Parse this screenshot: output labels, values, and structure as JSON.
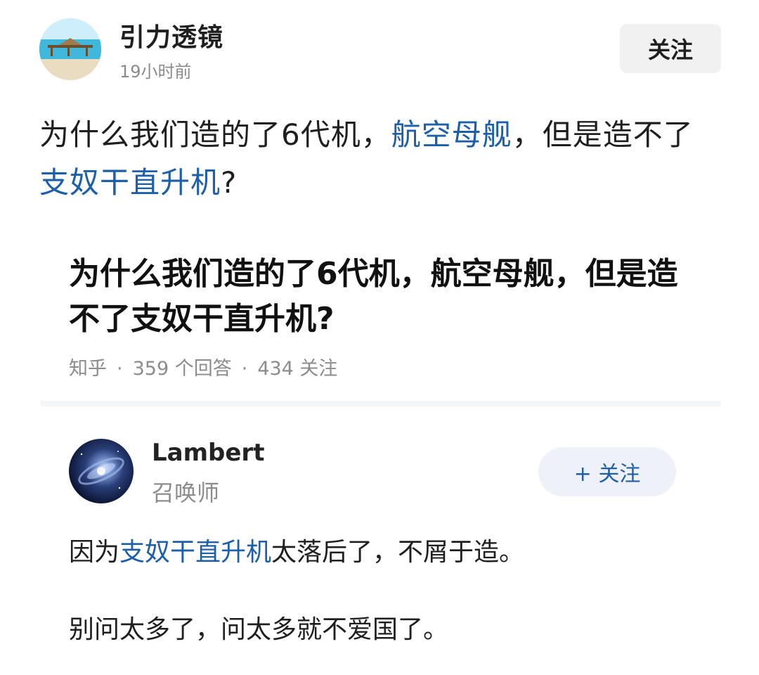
{
  "post": {
    "author": "引力透镜",
    "time": "19小时前",
    "follow_label": "关注",
    "text_part1": "为什么我们造的了6代机，",
    "link1": "航空母舰",
    "text_part2": "，但是造不了",
    "link2": "支奴干直升机",
    "text_part3": "?"
  },
  "embed": {
    "title": "为什么我们造的了6代机，航空母舰，但是造不了支奴干直升机?",
    "source": "知乎",
    "answers": "359 个回答",
    "followers": "434 关注",
    "separator": "·"
  },
  "answer": {
    "author": "Lambert",
    "title": "召唤师",
    "follow_label": "+ 关注",
    "line1_pre": "因为",
    "line1_link": "支奴干直升机",
    "line1_post": "太落后了，不屑于造。",
    "line2": "别问太多了，问太多就不爱国了。"
  },
  "colors": {
    "link": "#1d5fa8",
    "muted": "#8b8b8b"
  },
  "icons": {
    "author_avatar": "beach-avatar",
    "answer_avatar": "galaxy-avatar"
  }
}
